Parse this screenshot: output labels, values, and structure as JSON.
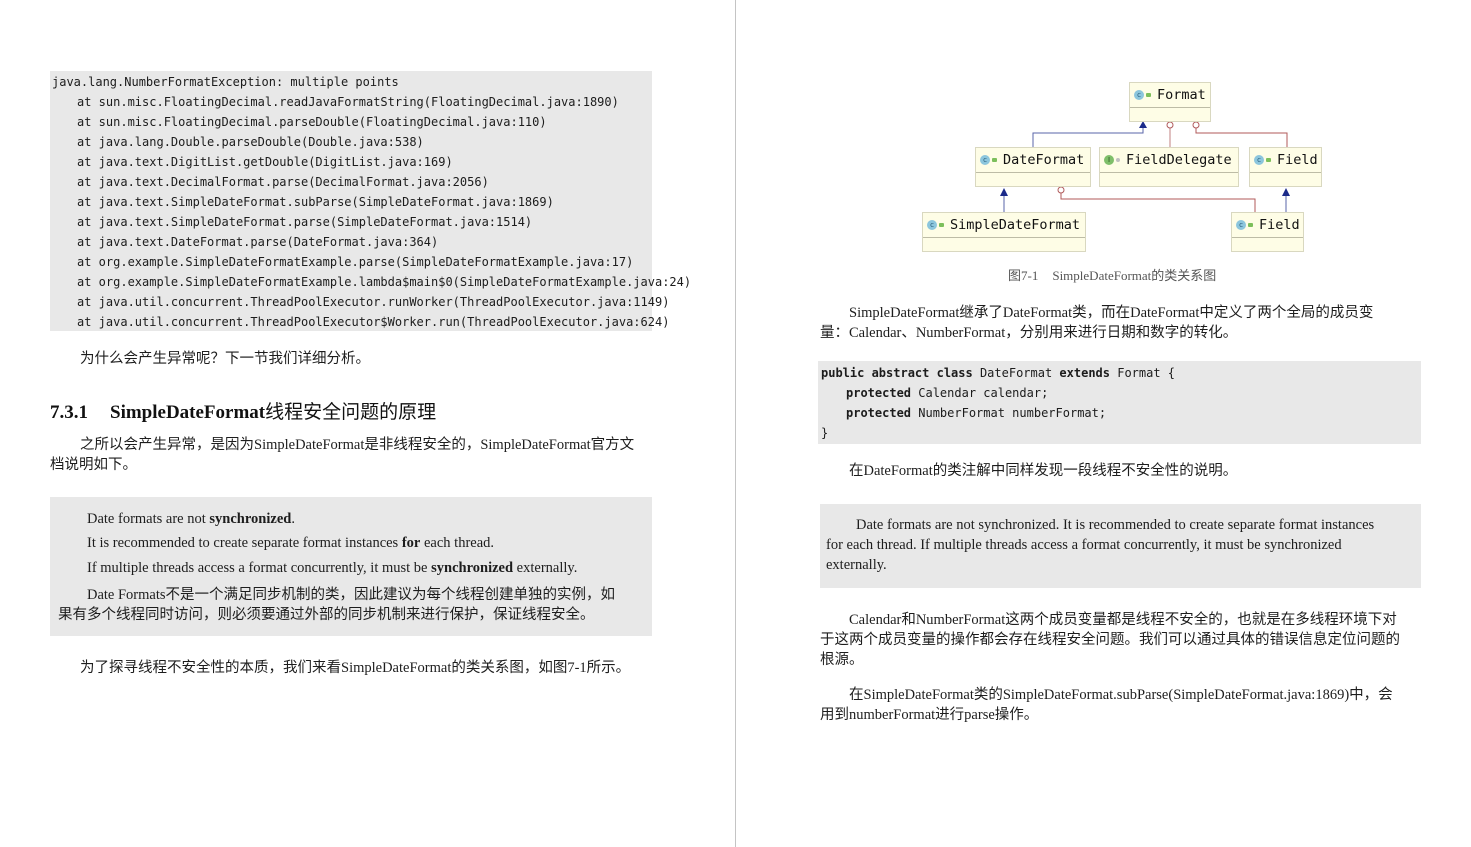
{
  "left_page": {
    "stack_trace": {
      "exception_line": "java.lang.NumberFormatException: multiple points",
      "frames": [
        "at sun.misc.FloatingDecimal.readJavaFormatString(FloatingDecimal.java:1890)",
        "at sun.misc.FloatingDecimal.parseDouble(FloatingDecimal.java:110)",
        "at java.lang.Double.parseDouble(Double.java:538)",
        "at java.text.DigitList.getDouble(DigitList.java:169)",
        "at java.text.DecimalFormat.parse(DecimalFormat.java:2056)",
        "at java.text.SimpleDateFormat.subParse(SimpleDateFormat.java:1869)",
        "at java.text.SimpleDateFormat.parse(SimpleDateFormat.java:1514)",
        "at java.text.DateFormat.parse(DateFormat.java:364)",
        "at org.example.SimpleDateFormatExample.parse(SimpleDateFormatExample.java:17)",
        "at org.example.SimpleDateFormatExample.lambda$main$0(SimpleDateFormatExample.java:24)",
        "at java.util.concurrent.ThreadPoolExecutor.runWorker(ThreadPoolExecutor.java:1149)",
        "at java.util.concurrent.ThreadPoolExecutor$Worker.run(ThreadPoolExecutor.java:624)"
      ]
    },
    "para_why": "为什么会产生异常呢？下一节我们详细分析。",
    "section": {
      "number": "7.3.1",
      "title_en": "SimpleDateFormat",
      "title_cn": "线程安全问题的原理"
    },
    "para_reason": "之所以会产生异常，是因为SimpleDateFormat是非线程安全的，SimpleDateFormat官方文档说明如下。",
    "quote": {
      "line1_pre": "Date formats are not ",
      "line1_bold": "synchronized",
      "line1_post": ".",
      "line2_pre": "It is recommended to create separate format instances ",
      "line2_bold": "for",
      "line2_post": " each thread.",
      "line3_pre": "If multiple threads access a format concurrently, it must be ",
      "line3_bold": "synchronized",
      "line3_post": " externally.",
      "cn_line1": "Date Formats不是一个满足同步机制的类，因此建议为每个线程创建单独的实例，如",
      "cn_line2": "果有多个线程同时访问，则必须要通过外部的同步机制来进行保护，保证线程安全。"
    },
    "para_explore": "为了探寻线程不安全性的本质，我们来看SimpleDateFormat的类关系图，如图7-1所示。"
  },
  "right_page": {
    "diagram": {
      "classes": {
        "format": "Format",
        "dateformat": "DateFormat",
        "fielddelegate": "FieldDelegate",
        "field_top": "Field",
        "simpledateformat": "SimpleDateFormat",
        "field_bottom": "Field"
      },
      "icons": {
        "class": "c",
        "interface": "I"
      },
      "colors": {
        "inheritance": "#1b2a8a",
        "inner_class": "#b05a5a",
        "box_fill": "#fefde6"
      },
      "caption_num": "图7-1",
      "caption_text": "SimpleDateFormat的类关系图"
    },
    "para_inherit_1": "SimpleDateFormat继承了DateFormat类，而在DateFormat中定义了两个全局的成员变",
    "para_inherit_2": "量：Calendar、NumberFormat，分别用来进行日期和数字的转化。",
    "code": {
      "l1_kw": "public abstract class",
      "l1_name": " DateFormat ",
      "l1_kw2": "extends",
      "l1_rest": " Format {",
      "l2_kw": "protected",
      "l2_rest": " Calendar calendar;",
      "l3_kw": "protected",
      "l3_rest": " NumberFormat numberFormat;",
      "l4": "}"
    },
    "para_annotation": "在DateFormat的类注解中同样发现一段线程不安全性的说明。",
    "quote_en_1": "Date formats are not synchronized. It is recommended to create separate format instances",
    "quote_en_2": "for each thread. If multiple threads access a format concurrently, it must be synchronized",
    "quote_en_3": "externally.",
    "para_members_1": "Calendar和NumberFormat这两个成员变量都是线程不安全的，也就是在多线程环境下对",
    "para_members_2": "于这两个成员变量的操作都会存在线程安全问题。我们可以通过具体的错误信息定位问题的",
    "para_members_3": "根源。",
    "para_subparse_1": "在SimpleDateFormat类的SimpleDateFormat.subParse(SimpleDateFormat.java:1869)中，会",
    "para_subparse_2": "用到numberFormat进行parse操作。"
  }
}
